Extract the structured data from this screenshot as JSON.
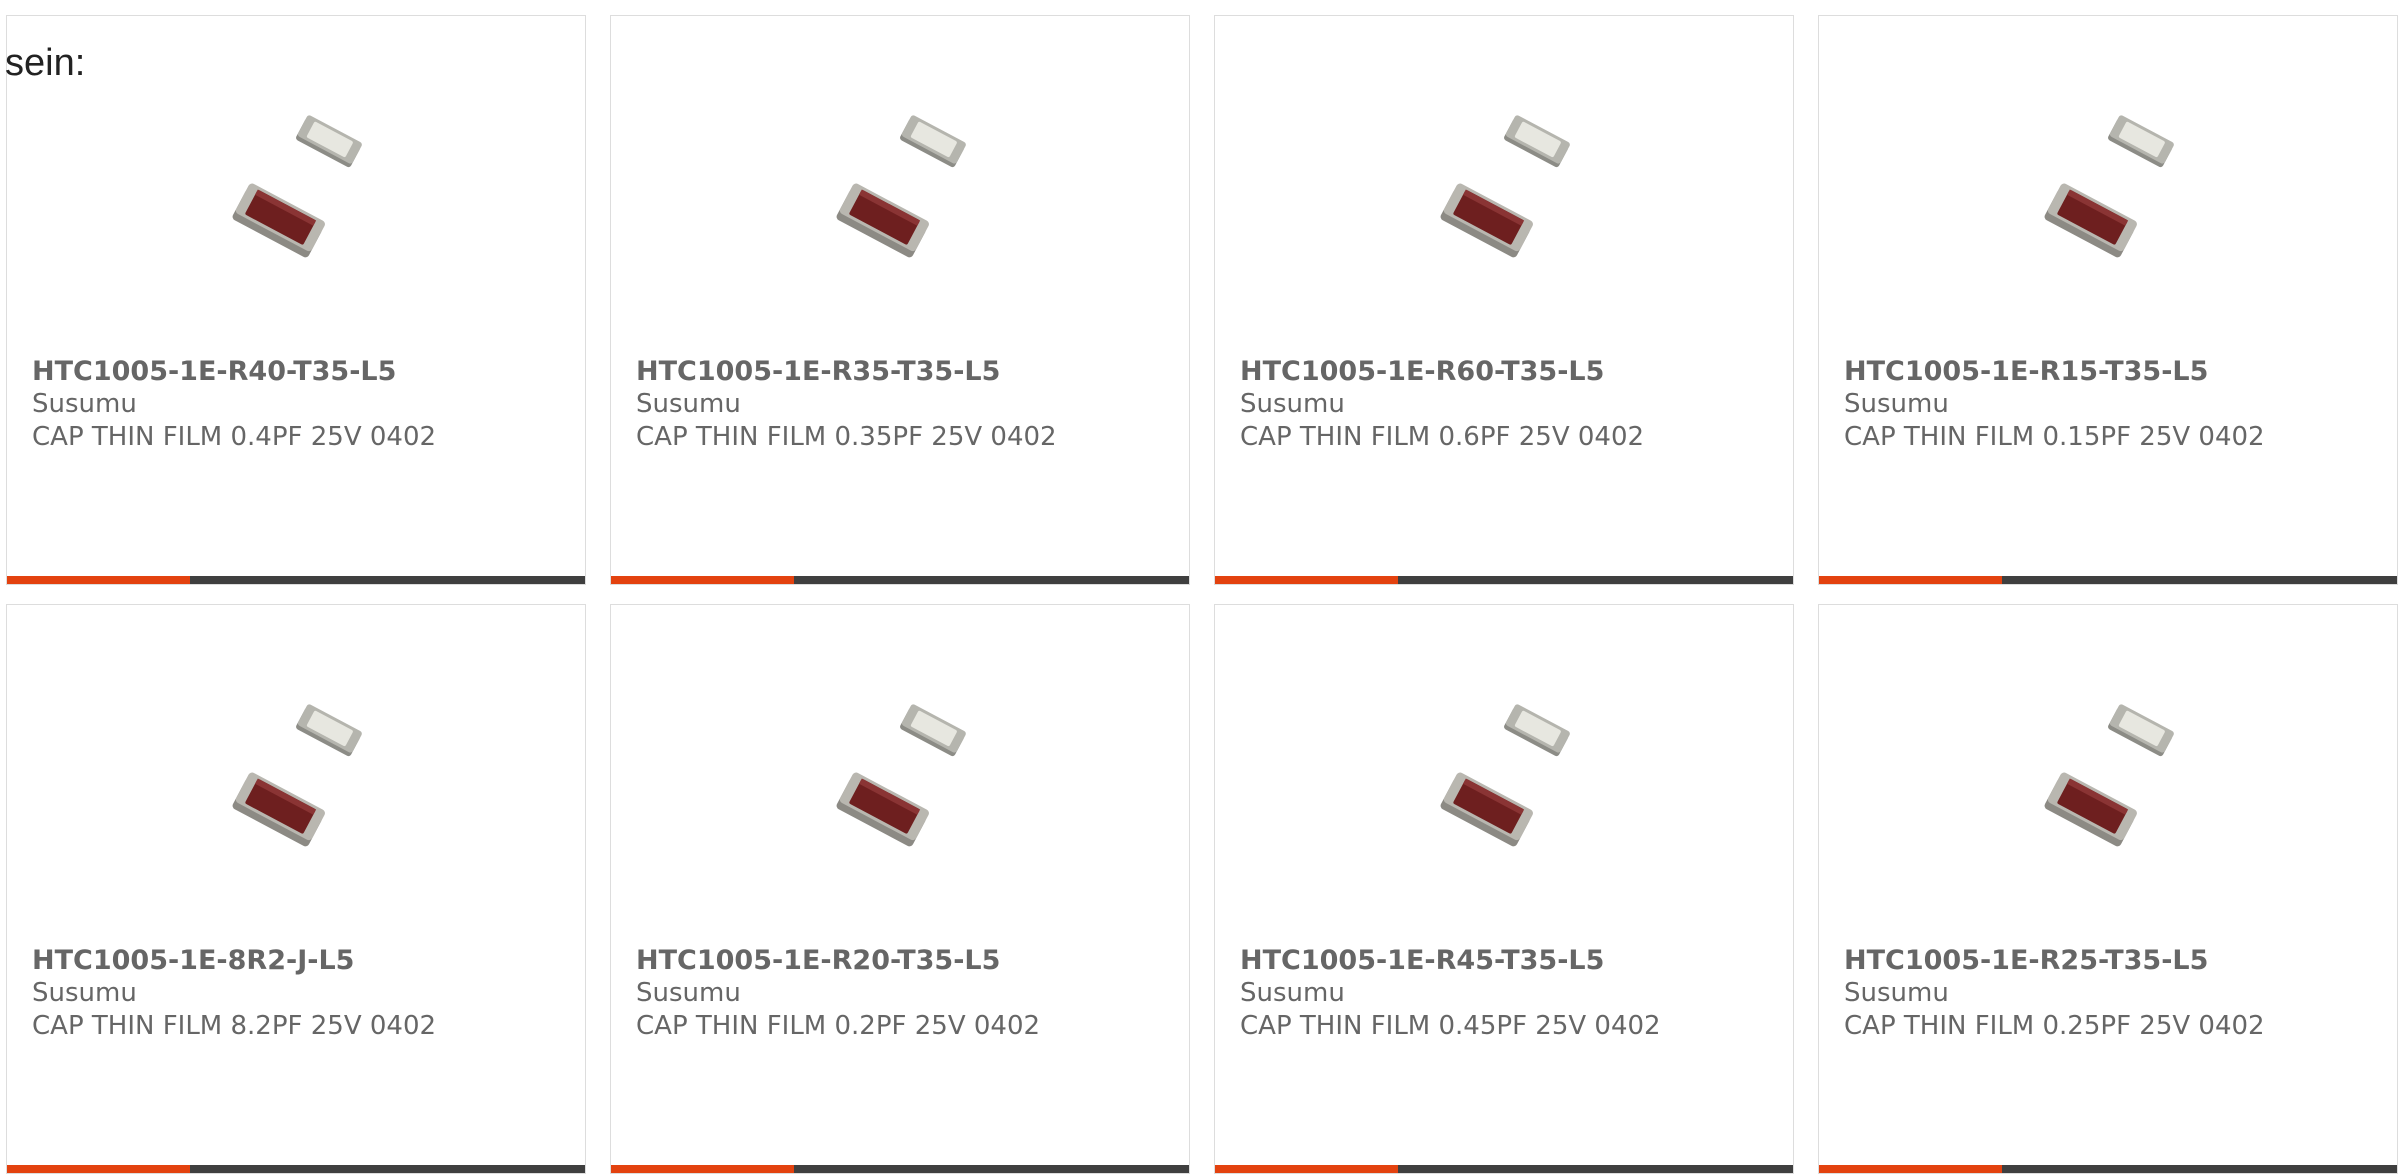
{
  "intro_text": "sein:",
  "colors": {
    "accent": "#e3420f",
    "bar": "#3f3f3f",
    "text": "#666666",
    "border": "#dddddd"
  },
  "products": [
    {
      "part_number": "HTC1005-1E-R40-T35-L5",
      "manufacturer": "Susumu",
      "description": "CAP THIN FILM 0.4PF 25V 0402"
    },
    {
      "part_number": "HTC1005-1E-R35-T35-L5",
      "manufacturer": "Susumu",
      "description": "CAP THIN FILM 0.35PF 25V 0402"
    },
    {
      "part_number": "HTC1005-1E-R60-T35-L5",
      "manufacturer": "Susumu",
      "description": "CAP THIN FILM 0.6PF 25V 0402"
    },
    {
      "part_number": "HTC1005-1E-R15-T35-L5",
      "manufacturer": "Susumu",
      "description": "CAP THIN FILM 0.15PF 25V 0402"
    },
    {
      "part_number": "HTC1005-1E-8R2-J-L5",
      "manufacturer": "Susumu",
      "description": "CAP THIN FILM 8.2PF 25V 0402"
    },
    {
      "part_number": "HTC1005-1E-R20-T35-L5",
      "manufacturer": "Susumu",
      "description": "CAP THIN FILM 0.2PF 25V 0402"
    },
    {
      "part_number": "HTC1005-1E-R45-T35-L5",
      "manufacturer": "Susumu",
      "description": "CAP THIN FILM 0.45PF 25V 0402"
    },
    {
      "part_number": "HTC1005-1E-R25-T35-L5",
      "manufacturer": "Susumu",
      "description": "CAP THIN FILM 0.25PF 25V 0402"
    }
  ]
}
